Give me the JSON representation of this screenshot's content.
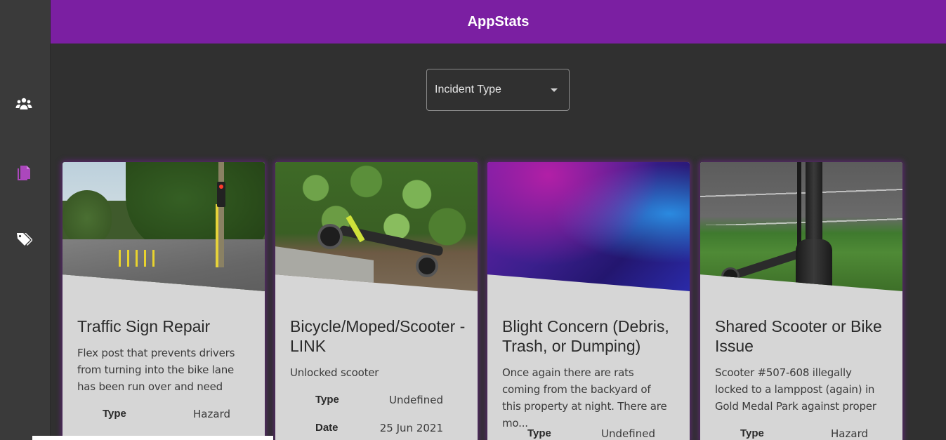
{
  "header": {
    "title": "AppStats"
  },
  "sidebar": {
    "items": [
      {
        "icon": "users-icon"
      },
      {
        "icon": "documents-icon",
        "active": true
      },
      {
        "icon": "tags-icon"
      }
    ],
    "active_color": "#ab47bc"
  },
  "filter": {
    "label": "Incident Type"
  },
  "colors": {
    "brand": "#7b1fa2",
    "background": "#303030",
    "card": "#d6d6d6"
  },
  "cards": [
    {
      "title": "Traffic Sign Repair",
      "description": "Flex post that prevents drivers from turning into the bike lane has been run over and need",
      "meta": [
        {
          "key": "Type",
          "value": "Hazard"
        }
      ]
    },
    {
      "title": "Bicycle/Moped/Scooter - LINK",
      "description": "Unlocked scooter",
      "meta": [
        {
          "key": "Type",
          "value": "Undefined"
        },
        {
          "key": "Date",
          "value": "25 Jun 2021"
        }
      ]
    },
    {
      "title": "Blight Concern (Debris, Trash, or Dumping)",
      "description": "Once again there are rats coming from the backyard of this property at night. There are mo...",
      "meta": [
        {
          "key": "Type",
          "value": "Undefined"
        }
      ]
    },
    {
      "title": "Shared Scooter or Bike Issue",
      "description": "Scooter #507-608 illegally locked to a lamppost (again) in Gold Medal Park against proper",
      "meta": [
        {
          "key": "Type",
          "value": "Hazard"
        }
      ]
    }
  ]
}
